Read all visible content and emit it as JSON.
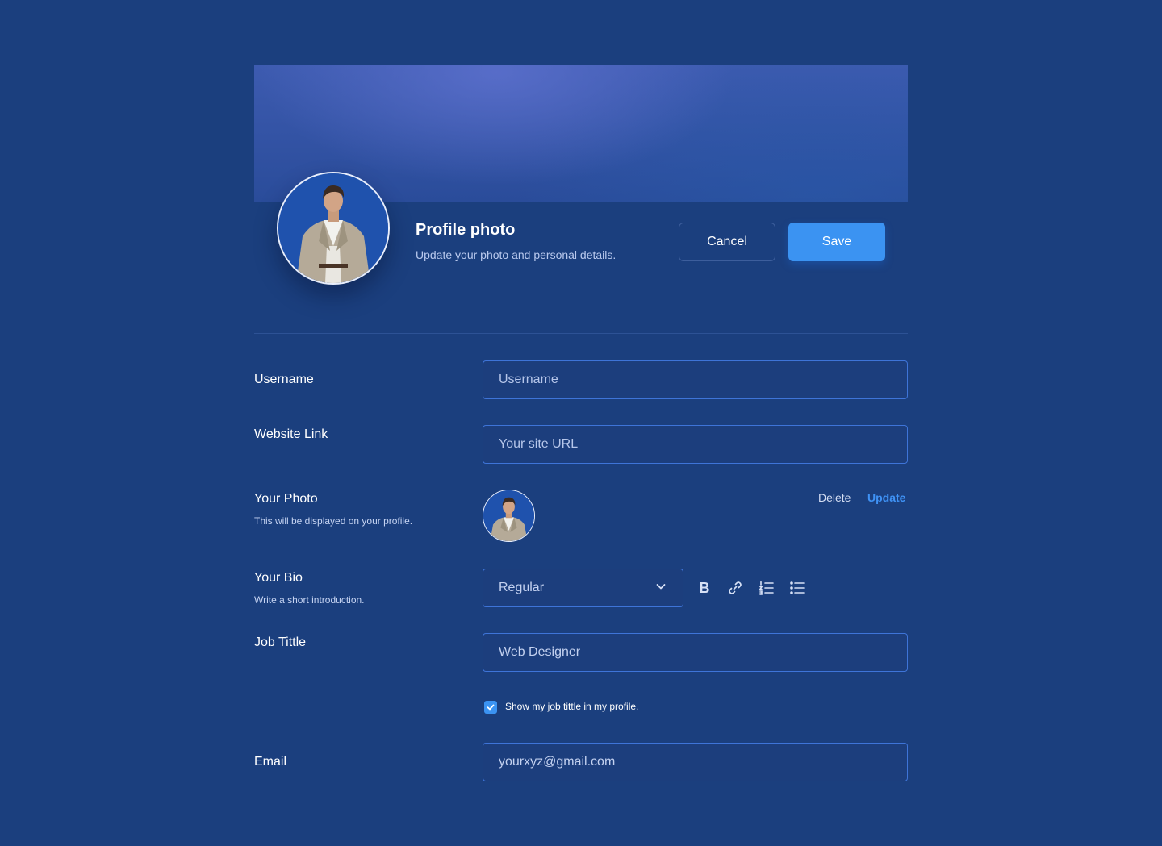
{
  "profile_header": {
    "title": "Profile photo",
    "subtitle": "Update your photo and personal details.",
    "cancel_label": "Cancel",
    "save_label": "Save"
  },
  "form": {
    "username": {
      "label": "Username",
      "placeholder": "Username"
    },
    "website": {
      "label": "Website Link",
      "placeholder": "Your site URL"
    },
    "photo": {
      "label": "Your Photo",
      "hint": "This will be displayed on your profile.",
      "delete_label": "Delete",
      "update_label": "Update"
    },
    "bio": {
      "label": "Your Bio",
      "hint": "Write a short introduction.",
      "text_style_selected": "Regular",
      "toolbar": {
        "bold_label": "B",
        "icons": [
          "bold-icon",
          "link-icon",
          "numbered-list-icon",
          "bullet-list-icon"
        ]
      }
    },
    "job_title": {
      "label": "Job Tittle",
      "value": "Web Designer",
      "show_in_profile_label": "Show my job tittle in my profile.",
      "show_in_profile_checked": true
    },
    "email": {
      "label": "Email",
      "value": "yourxyz@gmail.com"
    }
  },
  "colors": {
    "background": "#1b3f7e",
    "accent": "#3b93f2",
    "input_border": "#3e74d8",
    "link_accent": "#3f92f5"
  }
}
